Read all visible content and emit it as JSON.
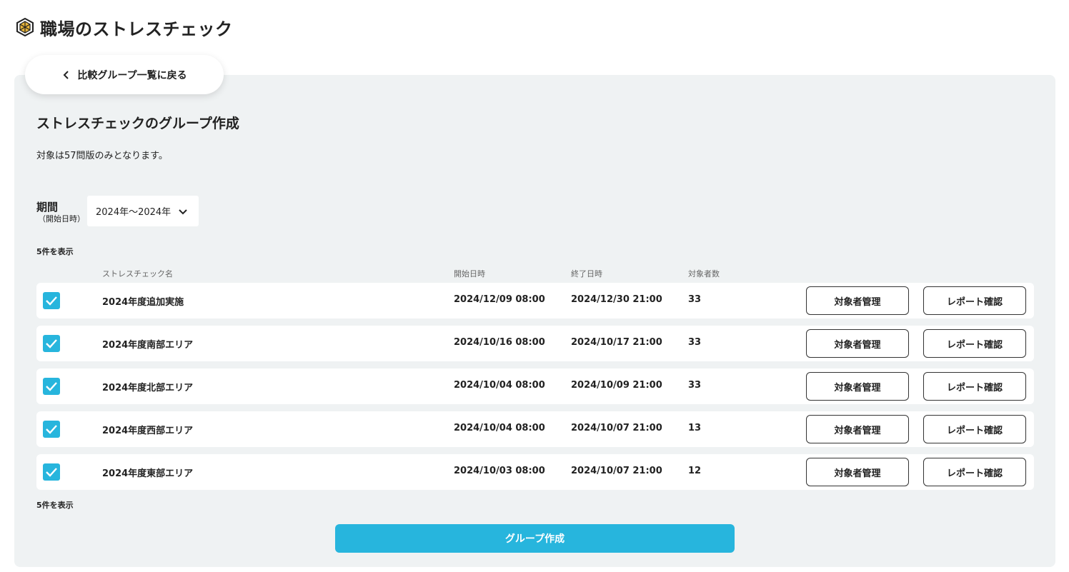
{
  "app": {
    "title": "職場のストレスチェック"
  },
  "back_button": {
    "label": "比較グループ一覧に戻る"
  },
  "section": {
    "title": "ストレスチェックのグループ作成",
    "note": "対象は57問版のみとなります。"
  },
  "filter": {
    "label": "期間",
    "sublabel": "（開始日時）",
    "selected": "2024年〜2024年"
  },
  "count_label": "5件を表示",
  "table": {
    "headers": {
      "name": "ストレスチェック名",
      "start": "開始日時",
      "end": "終了日時",
      "targets": "対象者数"
    },
    "rows": [
      {
        "checked": true,
        "name": "2024年度追加実施",
        "start": "2024/12/09 08:00",
        "end": "2024/12/30 21:00",
        "targets": "33",
        "manage": "対象者管理",
        "report": "レポート確認"
      },
      {
        "checked": true,
        "name": "2024年度南部エリア",
        "start": "2024/10/16 08:00",
        "end": "2024/10/17 21:00",
        "targets": "33",
        "manage": "対象者管理",
        "report": "レポート確認"
      },
      {
        "checked": true,
        "name": "2024年度北部エリア",
        "start": "2024/10/04 08:00",
        "end": "2024/10/09 21:00",
        "targets": "33",
        "manage": "対象者管理",
        "report": "レポート確認"
      },
      {
        "checked": true,
        "name": "2024年度西部エリア",
        "start": "2024/10/04 08:00",
        "end": "2024/10/07 21:00",
        "targets": "13",
        "manage": "対象者管理",
        "report": "レポート確認"
      },
      {
        "checked": true,
        "name": "2024年度東部エリア",
        "start": "2024/10/03 08:00",
        "end": "2024/10/07 21:00",
        "targets": "12",
        "manage": "対象者管理",
        "report": "レポート確認"
      }
    ]
  },
  "create_button": {
    "label": "グループ作成"
  },
  "colors": {
    "accent": "#27b5dd",
    "panel_bg": "#eff2f3",
    "text": "#222222"
  },
  "icons": {
    "logo": "hexagon-logo-icon",
    "back": "chevron-left-icon",
    "dropdown": "chevron-down-icon",
    "checkbox": "check-icon"
  }
}
